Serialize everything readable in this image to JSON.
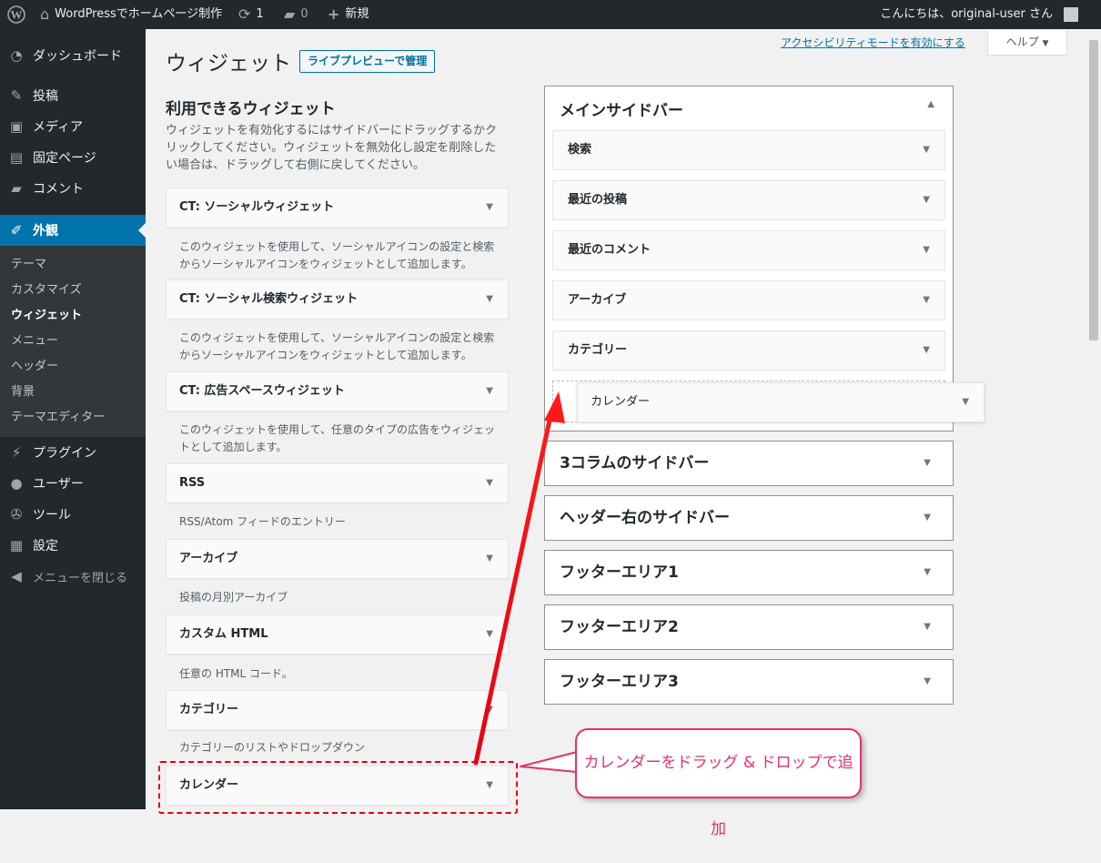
{
  "adminbar": {
    "site_name": "WordPressでホームページ制作",
    "updates": "1",
    "comments": "0",
    "new_label": "新規",
    "greeting": "こんにちは、original-user さん"
  },
  "menu": {
    "dashboard": "ダッシュボード",
    "posts": "投稿",
    "media": "メディア",
    "pages": "固定ページ",
    "comments": "コメント",
    "appearance": "外観",
    "plugins": "プラグイン",
    "users": "ユーザー",
    "tools": "ツール",
    "settings": "設定",
    "collapse": "メニューを閉じる",
    "submenu": [
      "テーマ",
      "カスタマイズ",
      "ウィジェット",
      "メニュー",
      "ヘッダー",
      "背景",
      "テーマエディター"
    ]
  },
  "header": {
    "title": "ウィジェット",
    "live_preview_button": "ライブプレビューで管理",
    "a11y_link": "アクセシビリティモードを有効にする",
    "help_button": "ヘルプ"
  },
  "available": {
    "heading": "利用できるウィジェット",
    "description": "ウィジェットを有効化するにはサイドバーにドラッグするかクリックしてください。ウィジェットを無効化し設定を削除したい場合は、ドラッグして右側に戻してください。",
    "widgets": [
      {
        "title": "CT: ソーシャルウィジェット",
        "desc": "このウィジェットを使用して、ソーシャルアイコンの設定と検索からソーシャルアイコンをウィジェットとして追加します。"
      },
      {
        "title": "CT: ソーシャル検索ウィジェット",
        "desc": "このウィジェットを使用して、ソーシャルアイコンの設定と検索からソーシャルアイコンをウィジェットとして追加します。"
      },
      {
        "title": "CT: 広告スペースウィジェット",
        "desc": "このウィジェットを使用して、任意のタイプの広告をウィジェットとして追加します。"
      },
      {
        "title": "RSS",
        "desc": "RSS/Atom フィードのエントリー"
      },
      {
        "title": "アーカイブ",
        "desc": "投稿の月別アーカイブ"
      },
      {
        "title": "カスタム HTML",
        "desc": "任意の HTML コード。"
      },
      {
        "title": "カテゴリー",
        "desc": "カテゴリーのリストやドロップダウン"
      },
      {
        "title": "カレンダー",
        "desc": ""
      }
    ]
  },
  "sidebars": {
    "main": {
      "title": "メインサイドバー",
      "widgets": [
        "検索",
        "最近の投稿",
        "最近のコメント",
        "アーカイブ",
        "カテゴリー"
      ]
    },
    "dragging_widget": "カレンダー",
    "others": [
      "3コラムのサイドバー",
      "ヘッダー右のサイドバー",
      "フッターエリア1",
      "フッターエリア2",
      "フッターエリア3"
    ]
  },
  "annotation": {
    "callout": "カレンダーをドラッグ & ドロップで追加"
  }
}
